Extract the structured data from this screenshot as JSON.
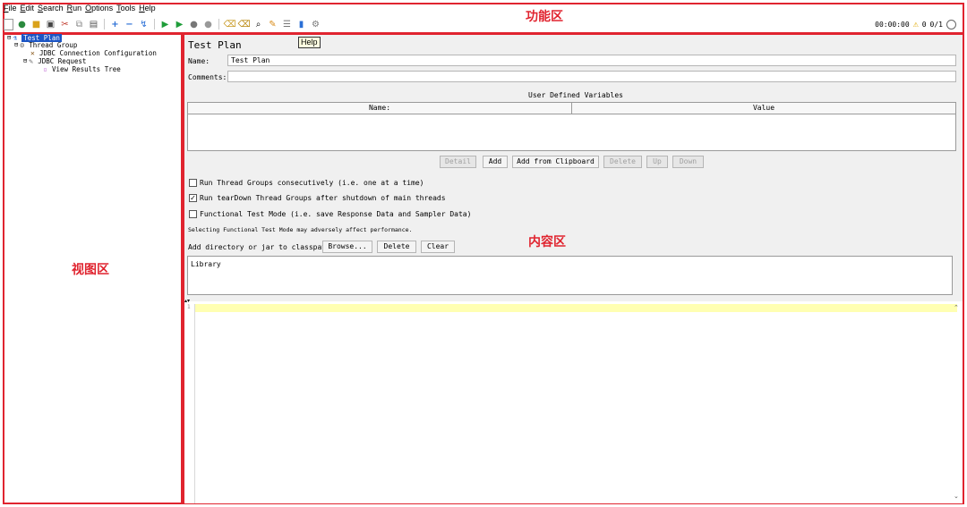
{
  "menu": [
    "File",
    "Edit",
    "Search",
    "Run",
    "Options",
    "Tools",
    "Help"
  ],
  "status": {
    "timer": "00:00:00",
    "warning_count": "0",
    "threads": "0/1"
  },
  "zone_labels": {
    "function": "功能区",
    "view": "视图区",
    "content": "内容区"
  },
  "tree": {
    "test_plan": "Test Plan",
    "thread_group": "Thread Group",
    "jdbc_config": "JDBC Connection Configuration",
    "jdbc_request": "JDBC Request",
    "view_results": "View Results Tree"
  },
  "panel": {
    "title": "Test Plan",
    "help_tooltip": "Help",
    "name_label": "Name:",
    "name_value": "Test Plan",
    "comments_label": "Comments:",
    "comments_value": "",
    "udv_title": "User Defined Variables",
    "table_headers": [
      "Name:",
      "Value"
    ],
    "buttons": {
      "detail": "Detail",
      "add": "Add",
      "add_clipboard": "Add from Clipboard",
      "delete": "Delete",
      "up": "Up",
      "down": "Down"
    },
    "options": [
      {
        "label": "Run Thread Groups consecutively (i.e. one at a time)",
        "checked": false
      },
      {
        "label": "Run tearDown Thread Groups after shutdown of main threads",
        "checked": true
      },
      {
        "label": "Functional Test Mode (i.e. save Response Data and Sampler Data)",
        "checked": false
      }
    ],
    "functional_note": "Selecting Functional Test Mode may adversely affect performance.",
    "classpath_label": "Add directory or jar to classpath",
    "classpath_buttons": {
      "browse": "Browse...",
      "delete": "Delete",
      "clear": "Clear"
    },
    "library_header": "Library"
  },
  "editor": {
    "line_number": "1"
  }
}
